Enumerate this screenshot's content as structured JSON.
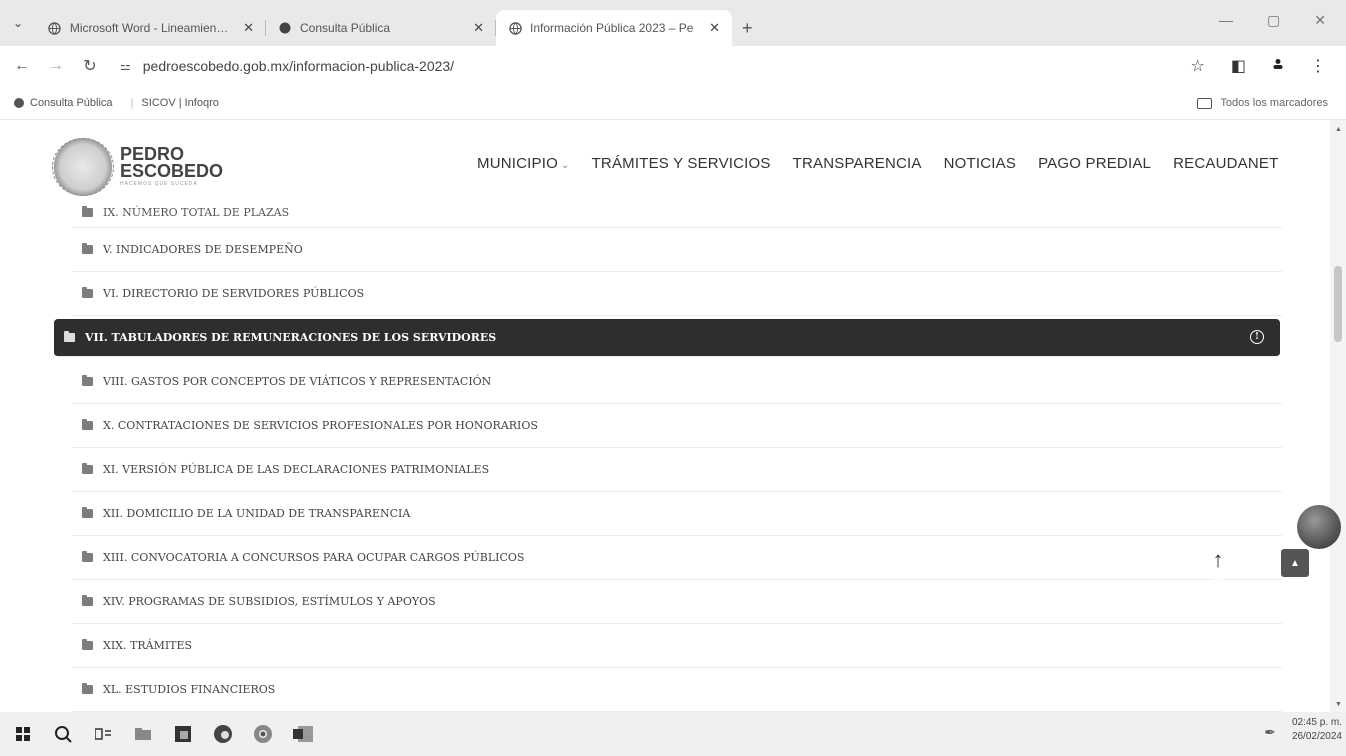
{
  "browser": {
    "tabs": [
      {
        "title": "Microsoft Word - Lineamiento_",
        "active": false
      },
      {
        "title": "Consulta Pública",
        "active": false
      },
      {
        "title": "Información Pública 2023 – Pe",
        "active": true
      }
    ],
    "url": "pedroescobedo.gob.mx/informacion-publica-2023/",
    "bookmarks": [
      "Consulta Pública",
      "SICOV | Infoqro"
    ],
    "all_bookmarks_label": "Todos los marcadores"
  },
  "site": {
    "logo": {
      "line1": "PEDRO",
      "line2": "ESCOBEDO",
      "tagline": "HACEMOS QUE SUCEDA"
    },
    "menu": [
      {
        "label": "MUNICIPIO",
        "has_dropdown": true
      },
      {
        "label": "TRÁMITES Y SERVICIOS",
        "has_dropdown": false
      },
      {
        "label": "TRANSPARENCIA",
        "has_dropdown": false
      },
      {
        "label": "NOTICIAS",
        "has_dropdown": false
      },
      {
        "label": "PAGO PREDIAL",
        "has_dropdown": false
      },
      {
        "label": "RECAUDANET",
        "has_dropdown": false
      }
    ]
  },
  "list": {
    "items": [
      {
        "label": "IX. NÚMERO TOTAL DE PLAZAS",
        "active": false
      },
      {
        "label": "V. INDICADORES DE DESEMPEÑO",
        "active": false
      },
      {
        "label": "VI. DIRECTORIO DE SERVIDORES PÚBLICOS",
        "active": false
      },
      {
        "label": "VII. TABULADORES DE REMUNERACIONES DE LOS SERVIDORES",
        "active": true
      },
      {
        "label": "VIII. GASTOS POR CONCEPTOS DE VIÁTICOS Y REPRESENTACIÓN",
        "active": false
      },
      {
        "label": "X. CONTRATACIONES DE SERVICIOS PROFESIONALES POR HONORARIOS",
        "active": false
      },
      {
        "label": "XI. VERSIÓN PÚBLICA DE LAS DECLARACIONES PATRIMONIALES",
        "active": false
      },
      {
        "label": "XII. DOMICILIO DE LA UNIDAD DE TRANSPARENCIA",
        "active": false
      },
      {
        "label": "XIII. CONVOCATORIA A CONCURSOS PARA OCUPAR CARGOS PÚBLICOS",
        "active": false
      },
      {
        "label": "XIV. PROGRAMAS DE SUBSIDIOS, ESTÍMULOS Y APOYOS",
        "active": false
      },
      {
        "label": "XIX. TRÁMITES",
        "active": false
      },
      {
        "label": "XL. ESTUDIOS FINANCIEROS",
        "active": false
      }
    ]
  },
  "taskbar": {
    "time": "02:45 p. m.",
    "date": "26/02/2024"
  }
}
